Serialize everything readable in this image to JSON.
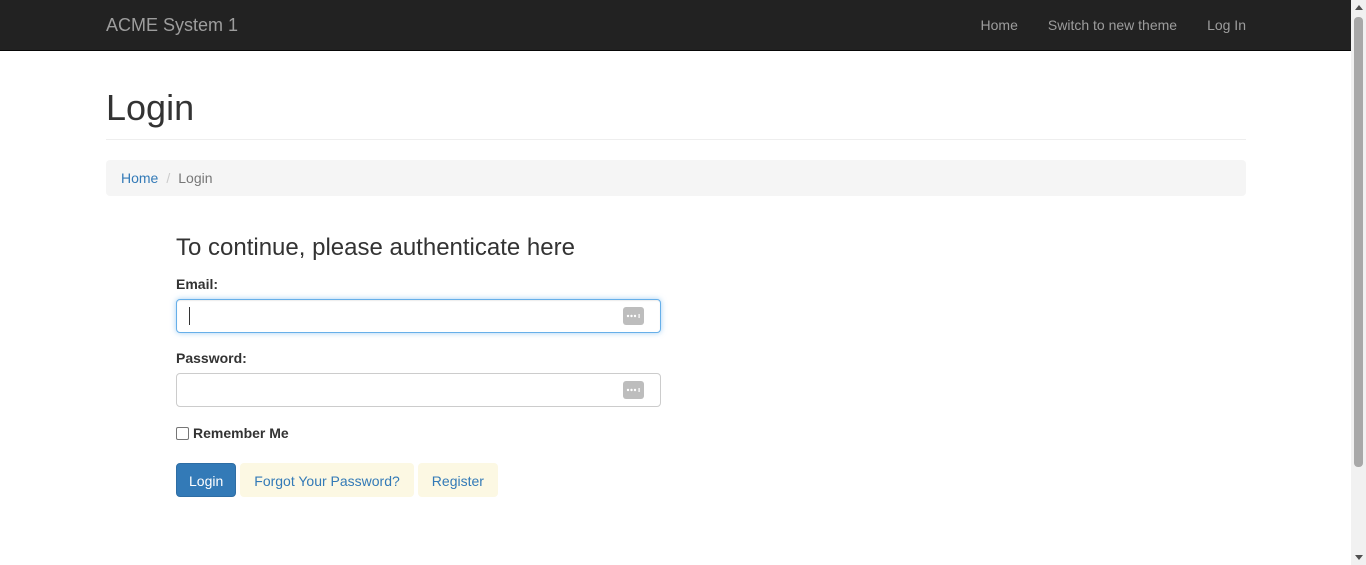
{
  "navbar": {
    "brand": "ACME System 1",
    "links": [
      {
        "label": "Home"
      },
      {
        "label": "Switch to new theme"
      },
      {
        "label": "Log In"
      }
    ]
  },
  "page": {
    "title": "Login"
  },
  "breadcrumb": {
    "home": "Home",
    "separator": "/",
    "current": "Login"
  },
  "form": {
    "heading": "To continue, please authenticate here",
    "email_label": "Email:",
    "email_value": "",
    "password_label": "Password:",
    "password_value": "",
    "remember_label": "Remember Me",
    "remember_checked": false,
    "login_button": "Login",
    "forgot_link": "Forgot Your Password?",
    "register_link": "Register"
  },
  "colors": {
    "navbar_bg": "#222222",
    "primary": "#337ab7",
    "link_bg": "#fcf8e3",
    "breadcrumb_bg": "#f5f5f5"
  },
  "icons": {
    "field_autofill": "password-manager-icon"
  }
}
